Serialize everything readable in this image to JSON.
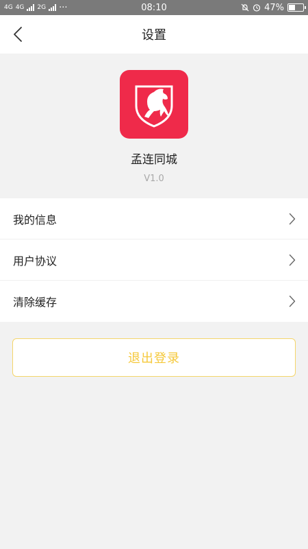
{
  "status_bar": {
    "network_1": "4G",
    "network_2": "4G",
    "network_3": "2G",
    "dots": "···",
    "time": "08:10",
    "battery_percent": "47%",
    "battery_level": 0.47
  },
  "nav": {
    "title": "设置"
  },
  "app": {
    "name": "孟连同城",
    "version": "V1.0"
  },
  "menu": {
    "items": [
      {
        "label": "我的信息"
      },
      {
        "label": "用户协议"
      },
      {
        "label": "清除缓存"
      }
    ]
  },
  "logout": {
    "label": "退出登录"
  },
  "colors": {
    "accent": "#f5c83a",
    "logo_bg": "#ef2a4a",
    "status_bar": "#7a7a7a"
  }
}
